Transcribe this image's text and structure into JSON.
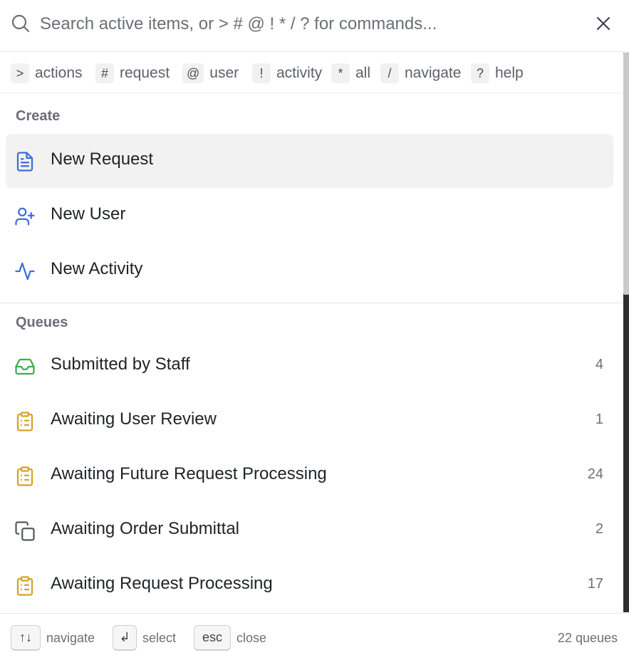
{
  "search": {
    "placeholder": "Search active items, or > # @ ! * / ? for commands..."
  },
  "filters": [
    {
      "key": ">",
      "label": "actions"
    },
    {
      "key": "#",
      "label": "request"
    },
    {
      "key": "@",
      "label": "user"
    },
    {
      "key": "!",
      "label": "activity"
    },
    {
      "key": "*",
      "label": "all"
    },
    {
      "key": "/",
      "label": "navigate"
    },
    {
      "key": "?",
      "label": "help"
    }
  ],
  "create": {
    "title": "Create",
    "items": [
      {
        "label": "New Request",
        "icon": "file-text-icon",
        "color": "#3b6fd4"
      },
      {
        "label": "New User",
        "icon": "user-plus-icon",
        "color": "#3b6fd4"
      },
      {
        "label": "New Activity",
        "icon": "activity-icon",
        "color": "#3b6fd4"
      }
    ]
  },
  "queues": {
    "title": "Queues",
    "items": [
      {
        "label": "Submitted by Staff",
        "count": "4",
        "icon": "inbox-icon",
        "color": "#3cae4a"
      },
      {
        "label": "Awaiting User Review",
        "count": "1",
        "icon": "clipboard-list-icon",
        "color": "#d6a126"
      },
      {
        "label": "Awaiting Future Request Processing",
        "count": "24",
        "icon": "clipboard-list-icon",
        "color": "#d6a126"
      },
      {
        "label": "Awaiting Order Submittal",
        "count": "2",
        "icon": "copy-icon",
        "color": "#555a61"
      },
      {
        "label": "Awaiting Request Processing",
        "count": "17",
        "icon": "clipboard-list-icon",
        "color": "#d6a126"
      }
    ]
  },
  "footer": {
    "navigate_key": "↑↓",
    "navigate_label": "navigate",
    "select_key": "↲",
    "select_label": "select",
    "close_key": "esc",
    "close_label": "close",
    "count_label": "22 queues"
  }
}
